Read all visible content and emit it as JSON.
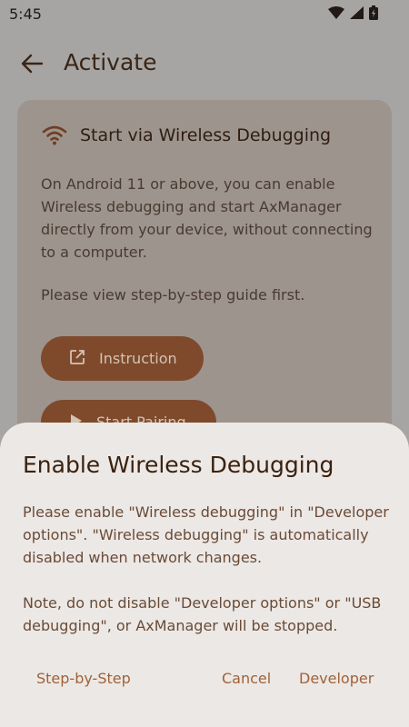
{
  "status_bar": {
    "time": "5:45",
    "icons": [
      "wifi-icon",
      "signal-icon",
      "battery-icon"
    ]
  },
  "app_bar": {
    "back_icon": "arrow-left-icon",
    "title": "Activate"
  },
  "card": {
    "icon": "wifi-icon",
    "title": "Start via Wireless Debugging",
    "body": "On Android 11 or above, you can enable Wireless debugging and start AxManager directly from your device, without connecting to a computer.",
    "note": "Please view step-by-step guide first.",
    "instruction_button": {
      "icon": "open-in-new-icon",
      "label": "Instruction"
    },
    "pairing_button": {
      "icon": "play-icon",
      "label": "Start Pairing"
    }
  },
  "dialog": {
    "title": "Enable Wireless Debugging",
    "body": "Please enable \"Wireless debugging\" in \"Developer options\". \"Wireless debugging\" is automatically disabled when network changes.",
    "note": "Note, do not disable \"Developer options\" or \"USB debugging\", or AxManager will be stopped.",
    "actions": {
      "step_by_step": "Step-by-Step",
      "cancel": "Cancel",
      "developer": "Developer"
    }
  },
  "colors": {
    "scrim_background": "#a6a5a4",
    "card_background": "#9d948e",
    "button_fill": "#7e4a2b",
    "sheet_background": "#ece8e5",
    "accent_text": "#a0623a"
  }
}
